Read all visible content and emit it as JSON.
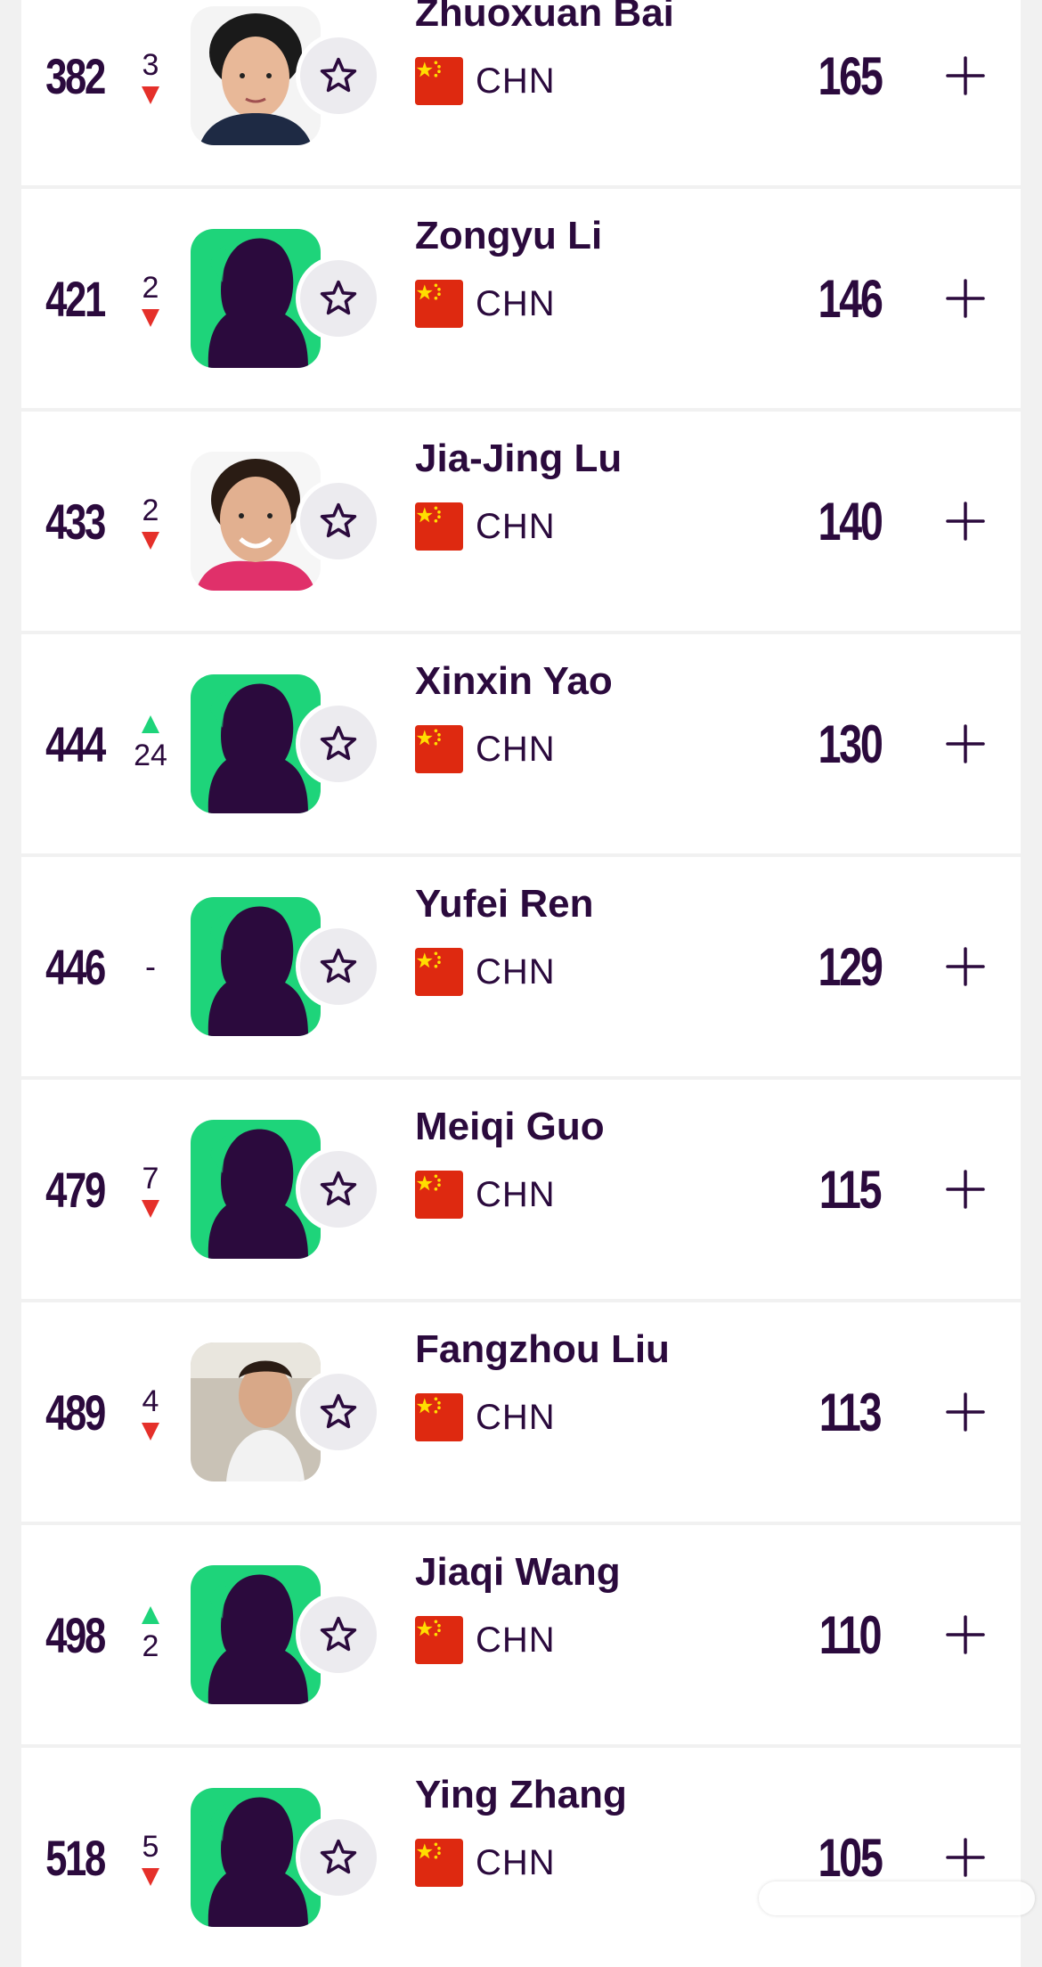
{
  "players": [
    {
      "rank": "382",
      "move": "3",
      "dir": "down",
      "name": "Zhuoxuan Bai",
      "country": "CHN",
      "points": "165",
      "avatar": "photo-a"
    },
    {
      "rank": "421",
      "move": "2",
      "dir": "down",
      "name": "Zongyu Li",
      "country": "CHN",
      "points": "146",
      "avatar": "silhouette"
    },
    {
      "rank": "433",
      "move": "2",
      "dir": "down",
      "name": "Jia-Jing Lu",
      "country": "CHN",
      "points": "140",
      "avatar": "photo-b"
    },
    {
      "rank": "444",
      "move": "24",
      "dir": "up",
      "name": "Xinxin Yao",
      "country": "CHN",
      "points": "130",
      "avatar": "silhouette"
    },
    {
      "rank": "446",
      "move": "-",
      "dir": "none",
      "name": "Yufei Ren",
      "country": "CHN",
      "points": "129",
      "avatar": "silhouette"
    },
    {
      "rank": "479",
      "move": "7",
      "dir": "down",
      "name": "Meiqi Guo",
      "country": "CHN",
      "points": "115",
      "avatar": "silhouette"
    },
    {
      "rank": "489",
      "move": "4",
      "dir": "down",
      "name": "Fangzhou Liu",
      "country": "CHN",
      "points": "113",
      "avatar": "photo-c"
    },
    {
      "rank": "498",
      "move": "2",
      "dir": "up",
      "name": "Jiaqi Wang",
      "country": "CHN",
      "points": "110",
      "avatar": "silhouette"
    },
    {
      "rank": "518",
      "move": "5",
      "dir": "down",
      "name": "Ying Zhang",
      "country": "CHN",
      "points": "105",
      "avatar": "silhouette"
    }
  ],
  "icons": {
    "favorite": "star-icon",
    "add": "plus-icon",
    "flag": "china-flag-icon",
    "move_down": "triangle-down-icon",
    "move_up": "triangle-up-icon"
  },
  "colors": {
    "text": "#2b0a3d",
    "down": "#e5302a",
    "up": "#1ed47a",
    "avatar_bg": "#1ed47a",
    "silhouette": "#2b0a3d",
    "flag": "#de2910",
    "star": "#ffde00"
  }
}
